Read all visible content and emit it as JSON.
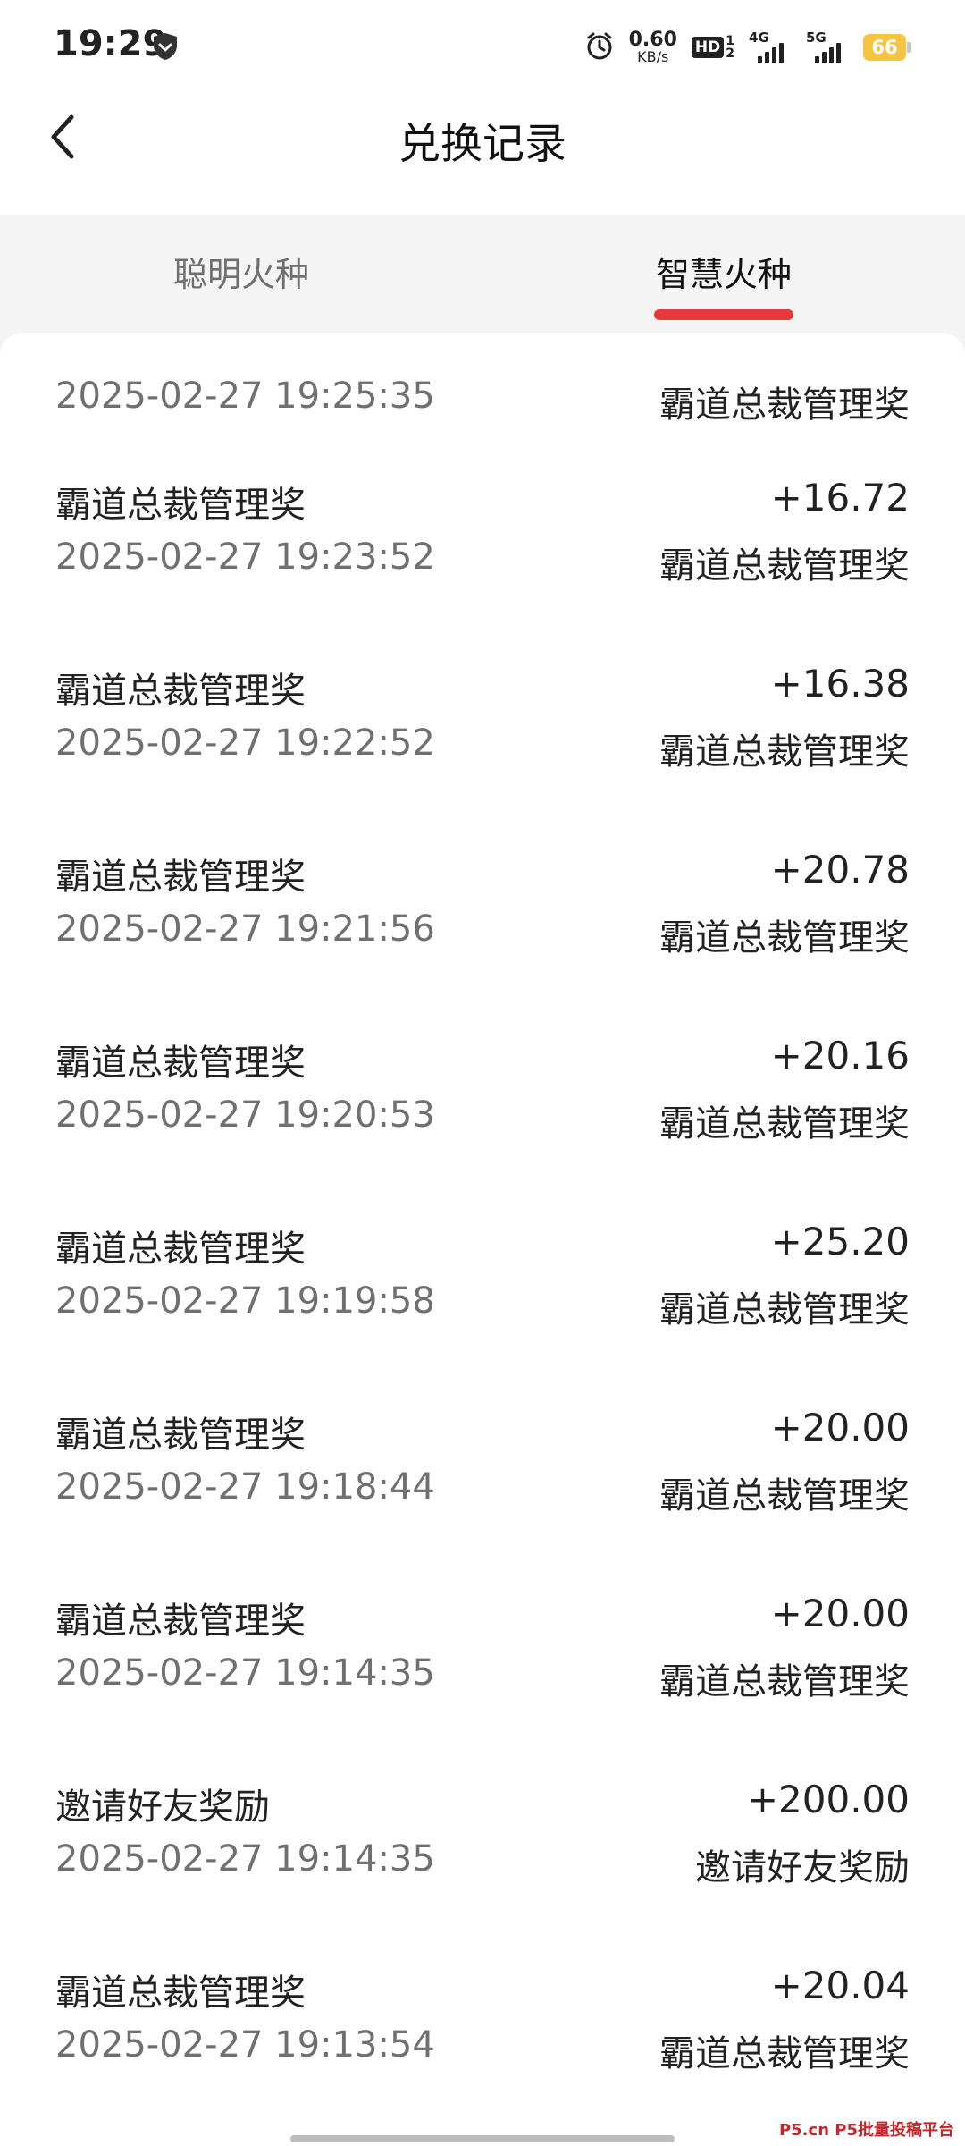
{
  "status": {
    "time": "19:29",
    "speed_value": "0.60",
    "speed_unit": "KB/s",
    "hd_label": "HD",
    "hd_sub_top": "1",
    "hd_sub_bottom": "2",
    "net1_label": "4G",
    "net2_label": "5G",
    "battery": "66",
    "battery_color": "#f6c343"
  },
  "header": {
    "title": "兑换记录",
    "back_icon": "chevron-left-icon"
  },
  "tabs": [
    {
      "label": "聪明火种",
      "active": false
    },
    {
      "label": "智慧火种",
      "active": true
    }
  ],
  "accent_color": "#e63a3a",
  "records": [
    {
      "title": "",
      "amount": "",
      "time": "2025-02-27 19:25:35",
      "desc": "霸道总裁管理奖"
    },
    {
      "title": "霸道总裁管理奖",
      "amount": "+16.72",
      "time": "2025-02-27 19:23:52",
      "desc": "霸道总裁管理奖"
    },
    {
      "title": "霸道总裁管理奖",
      "amount": "+16.38",
      "time": "2025-02-27 19:22:52",
      "desc": "霸道总裁管理奖"
    },
    {
      "title": "霸道总裁管理奖",
      "amount": "+20.78",
      "time": "2025-02-27 19:21:56",
      "desc": "霸道总裁管理奖"
    },
    {
      "title": "霸道总裁管理奖",
      "amount": "+20.16",
      "time": "2025-02-27 19:20:53",
      "desc": "霸道总裁管理奖"
    },
    {
      "title": "霸道总裁管理奖",
      "amount": "+25.20",
      "time": "2025-02-27 19:19:58",
      "desc": "霸道总裁管理奖"
    },
    {
      "title": "霸道总裁管理奖",
      "amount": "+20.00",
      "time": "2025-02-27 19:18:44",
      "desc": "霸道总裁管理奖"
    },
    {
      "title": "霸道总裁管理奖",
      "amount": "+20.00",
      "time": "2025-02-27 19:14:35",
      "desc": "霸道总裁管理奖"
    },
    {
      "title": "邀请好友奖励",
      "amount": "+200.00",
      "time": "2025-02-27 19:14:35",
      "desc": "邀请好友奖励"
    },
    {
      "title": "霸道总裁管理奖",
      "amount": "+20.04",
      "time": "2025-02-27 19:13:54",
      "desc": "霸道总裁管理奖"
    }
  ],
  "watermark": "P5.cn P5批量投稿平台"
}
